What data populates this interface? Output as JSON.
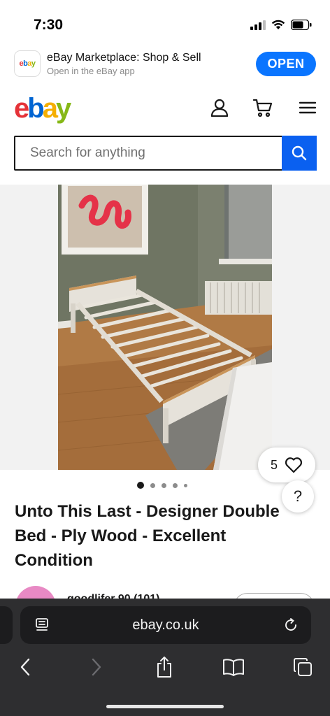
{
  "status_bar": {
    "time": "7:30"
  },
  "app_banner": {
    "icon_text": "ebay",
    "title": "eBay Marketplace: Shop & Sell",
    "subtitle": "Open in the eBay app",
    "open_label": "OPEN"
  },
  "header": {
    "logo": [
      "e",
      "b",
      "a",
      "y"
    ],
    "icons": [
      "account-icon",
      "cart-icon",
      "menu-icon"
    ]
  },
  "search": {
    "placeholder": "Search for anything"
  },
  "listing": {
    "watch_count": "5",
    "help_label": "?",
    "title": "Unto This Last - Designer Double Bed - Ply Wood - Excellent Condition",
    "image_count_dots": 5,
    "active_image": 1,
    "seller_name": "goodlifer 90 (101)"
  },
  "browser": {
    "url": "ebay.co.uk",
    "toolbar": [
      "back-icon",
      "forward-icon",
      "share-icon",
      "bookmarks-icon",
      "tabs-icon"
    ]
  },
  "colors": {
    "brand_blue": "#0a75ff",
    "search_blue": "#0a60f0",
    "logo_red": "#e53238",
    "logo_blue": "#0064d2",
    "logo_yellow": "#f5af02",
    "logo_green": "#86b817"
  }
}
